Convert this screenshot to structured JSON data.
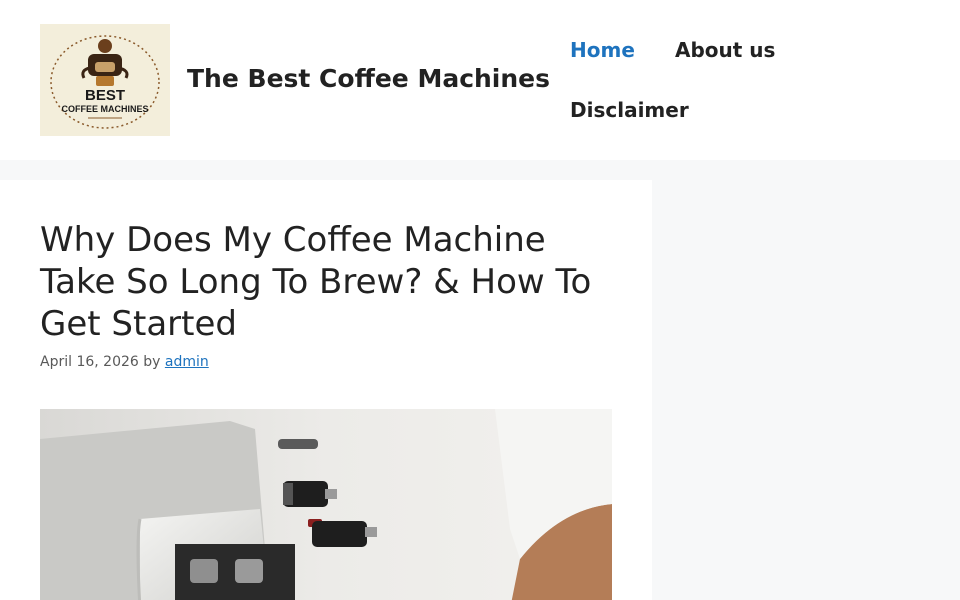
{
  "header": {
    "site_title": "The Best Coffee Machines",
    "logo": {
      "line1": "BEST",
      "line2": "COFFEE MACHINES"
    }
  },
  "nav": {
    "items": [
      {
        "label": "Home",
        "active": true
      },
      {
        "label": "About us",
        "active": false
      },
      {
        "label": "Disclaimer",
        "active": false
      }
    ]
  },
  "article": {
    "title": "Why Does My Coffee Machine Take So Long To Brew? & How To Get Started",
    "date": "April 16, 2026",
    "by_label": "by",
    "author": "admin"
  },
  "colors": {
    "accent": "#1e73be",
    "text": "#222222",
    "meta_text": "#595959",
    "page_background": "#f7f8f9"
  }
}
